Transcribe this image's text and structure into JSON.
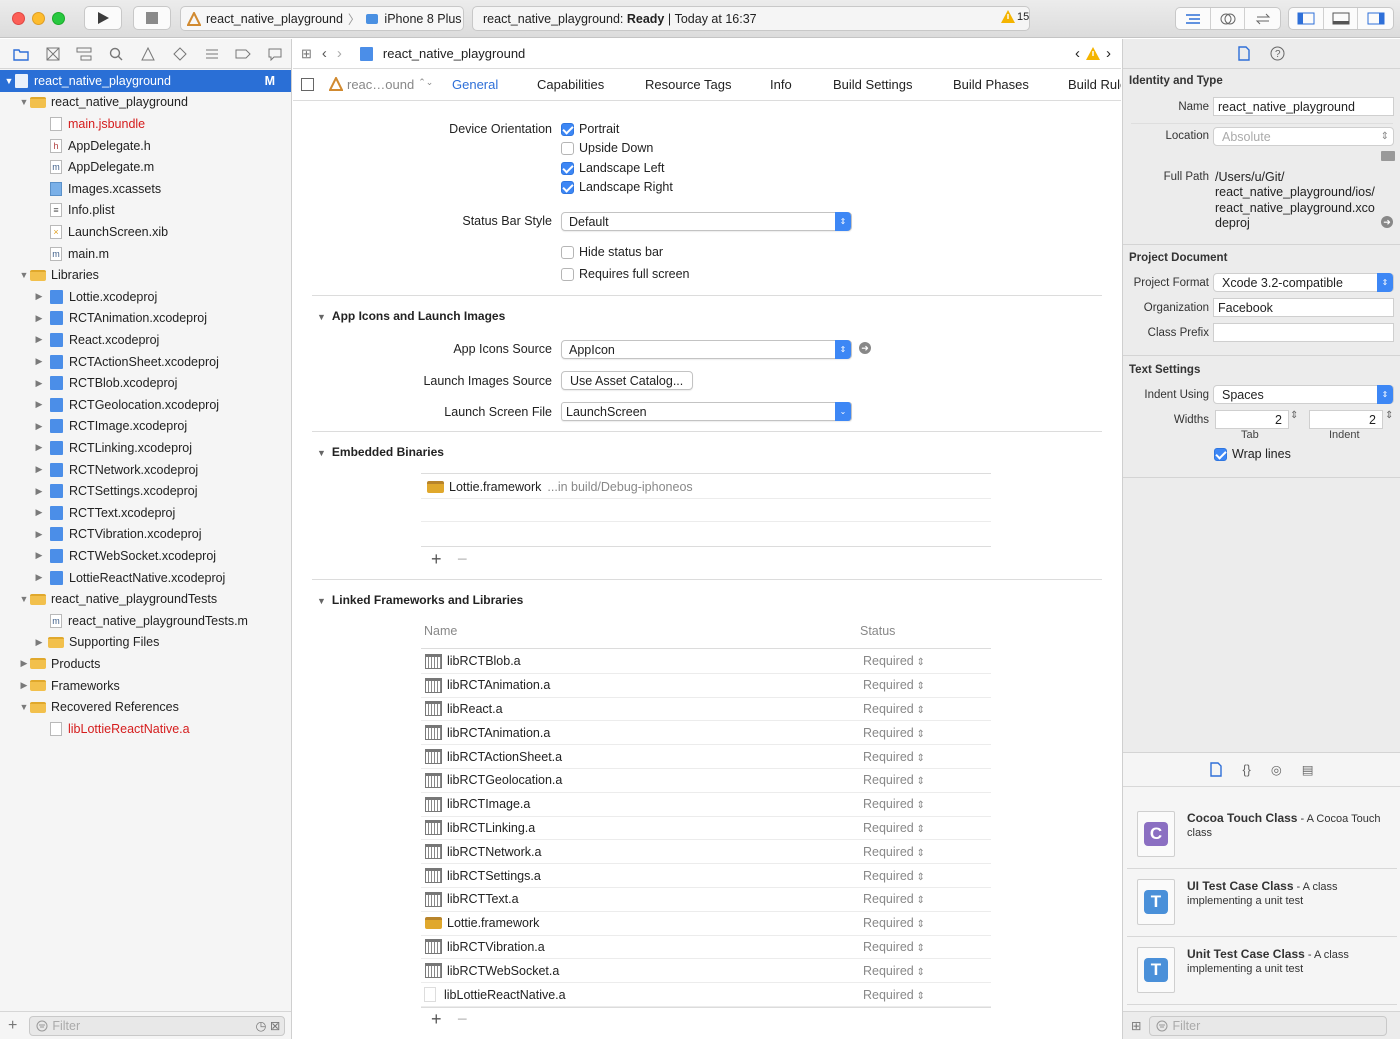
{
  "toolbar": {
    "scheme_target": "react_native_playground",
    "scheme_device": "iPhone 8 Plus",
    "status_project": "react_native_playground:",
    "status_state": "Ready",
    "status_time": "Today at 16:37",
    "warning_count": "15"
  },
  "navigator": {
    "items": [
      {
        "label": "react_native_playground",
        "badge": "M"
      },
      {
        "label": "react_native_playground"
      },
      {
        "label": "main.jsbundle"
      },
      {
        "label": "AppDelegate.h"
      },
      {
        "label": "AppDelegate.m"
      },
      {
        "label": "Images.xcassets"
      },
      {
        "label": "Info.plist"
      },
      {
        "label": "LaunchScreen.xib"
      },
      {
        "label": "main.m"
      },
      {
        "label": "Libraries"
      },
      {
        "label": "Lottie.xcodeproj"
      },
      {
        "label": "RCTAnimation.xcodeproj"
      },
      {
        "label": "React.xcodeproj"
      },
      {
        "label": "RCTActionSheet.xcodeproj"
      },
      {
        "label": "RCTBlob.xcodeproj"
      },
      {
        "label": "RCTGeolocation.xcodeproj"
      },
      {
        "label": "RCTImage.xcodeproj"
      },
      {
        "label": "RCTLinking.xcodeproj"
      },
      {
        "label": "RCTNetwork.xcodeproj"
      },
      {
        "label": "RCTSettings.xcodeproj"
      },
      {
        "label": "RCTText.xcodeproj"
      },
      {
        "label": "RCTVibration.xcodeproj"
      },
      {
        "label": "RCTWebSocket.xcodeproj"
      },
      {
        "label": "LottieReactNative.xcodeproj"
      },
      {
        "label": "react_native_playgroundTests"
      },
      {
        "label": "react_native_playgroundTests.m"
      },
      {
        "label": "Supporting Files"
      },
      {
        "label": "Products"
      },
      {
        "label": "Frameworks"
      },
      {
        "label": "Recovered References"
      },
      {
        "label": "libLottieReactNative.a"
      }
    ],
    "filter_placeholder": "Filter"
  },
  "editor": {
    "breadcrumb": "react_native_playground",
    "target_short": "reac…ound",
    "tabs": [
      "General",
      "Capabilities",
      "Resource Tags",
      "Info",
      "Build Settings",
      "Build Phases",
      "Build Rules"
    ],
    "device_orientation_label": "Device Orientation",
    "orientations": [
      {
        "label": "Portrait",
        "checked": true
      },
      {
        "label": "Upside Down",
        "checked": false
      },
      {
        "label": "Landscape Left",
        "checked": true
      },
      {
        "label": "Landscape Right",
        "checked": true
      }
    ],
    "status_bar_style_label": "Status Bar Style",
    "status_bar_style_value": "Default",
    "hide_status_bar": "Hide status bar",
    "requires_full_screen": "Requires full screen",
    "app_icons_section": "App Icons and Launch Images",
    "app_icons_source_label": "App Icons Source",
    "app_icons_source_value": "AppIcon",
    "launch_images_source_label": "Launch Images Source",
    "launch_images_source_button": "Use Asset Catalog...",
    "launch_screen_file_label": "Launch Screen File",
    "launch_screen_file_value": "LaunchScreen",
    "embedded_section": "Embedded Binaries",
    "embedded_name": "Lottie.framework",
    "embedded_path": "...in build/Debug-iphoneos",
    "linked_section": "Linked Frameworks and Libraries",
    "col_name": "Name",
    "col_status": "Status",
    "libraries": [
      {
        "name": "libRCTBlob.a",
        "status": "Required"
      },
      {
        "name": "libRCTAnimation.a",
        "status": "Required"
      },
      {
        "name": "libReact.a",
        "status": "Required"
      },
      {
        "name": "libRCTAnimation.a",
        "status": "Required"
      },
      {
        "name": "libRCTActionSheet.a",
        "status": "Required"
      },
      {
        "name": "libRCTGeolocation.a",
        "status": "Required"
      },
      {
        "name": "libRCTImage.a",
        "status": "Required"
      },
      {
        "name": "libRCTLinking.a",
        "status": "Required"
      },
      {
        "name": "libRCTNetwork.a",
        "status": "Required"
      },
      {
        "name": "libRCTSettings.a",
        "status": "Required"
      },
      {
        "name": "libRCTText.a",
        "status": "Required"
      },
      {
        "name": "Lottie.framework",
        "status": "Required"
      },
      {
        "name": "libRCTVibration.a",
        "status": "Required"
      },
      {
        "name": "libRCTWebSocket.a",
        "status": "Required"
      },
      {
        "name": "libLottieReactNative.a",
        "status": "Required"
      }
    ]
  },
  "inspector": {
    "identity_title": "Identity and Type",
    "name_label": "Name",
    "name_value": "react_native_playground",
    "location_label": "Location",
    "location_value": "Absolute",
    "full_path_label": "Full Path",
    "full_path_lines": [
      "/Users/u/Git/",
      "react_native_playground/ios/",
      "react_native_playground.xco",
      "deproj"
    ],
    "project_doc_title": "Project Document",
    "project_format_label": "Project Format",
    "project_format_value": "Xcode 3.2-compatible",
    "organization_label": "Organization",
    "organization_value": "Facebook",
    "class_prefix_label": "Class Prefix",
    "text_settings_title": "Text Settings",
    "indent_using_label": "Indent Using",
    "indent_using_value": "Spaces",
    "widths_label": "Widths",
    "tab_value": "2",
    "indent_value": "2",
    "tab_label": "Tab",
    "indent_label": "Indent",
    "wrap_lines": "Wrap lines",
    "templates": [
      {
        "name": "Cocoa Touch Class",
        "desc": " - A Cocoa Touch class",
        "letter": "C",
        "color": "#8b6fc2"
      },
      {
        "name": "UI Test Case Class",
        "desc": " - A class implementing a unit test",
        "letter": "T",
        "color": "#4a90d9"
      },
      {
        "name": "Unit Test Case Class",
        "desc": " - A class implementing a unit test",
        "letter": "T",
        "color": "#4a90d9"
      }
    ],
    "filter_placeholder": "Filter"
  }
}
